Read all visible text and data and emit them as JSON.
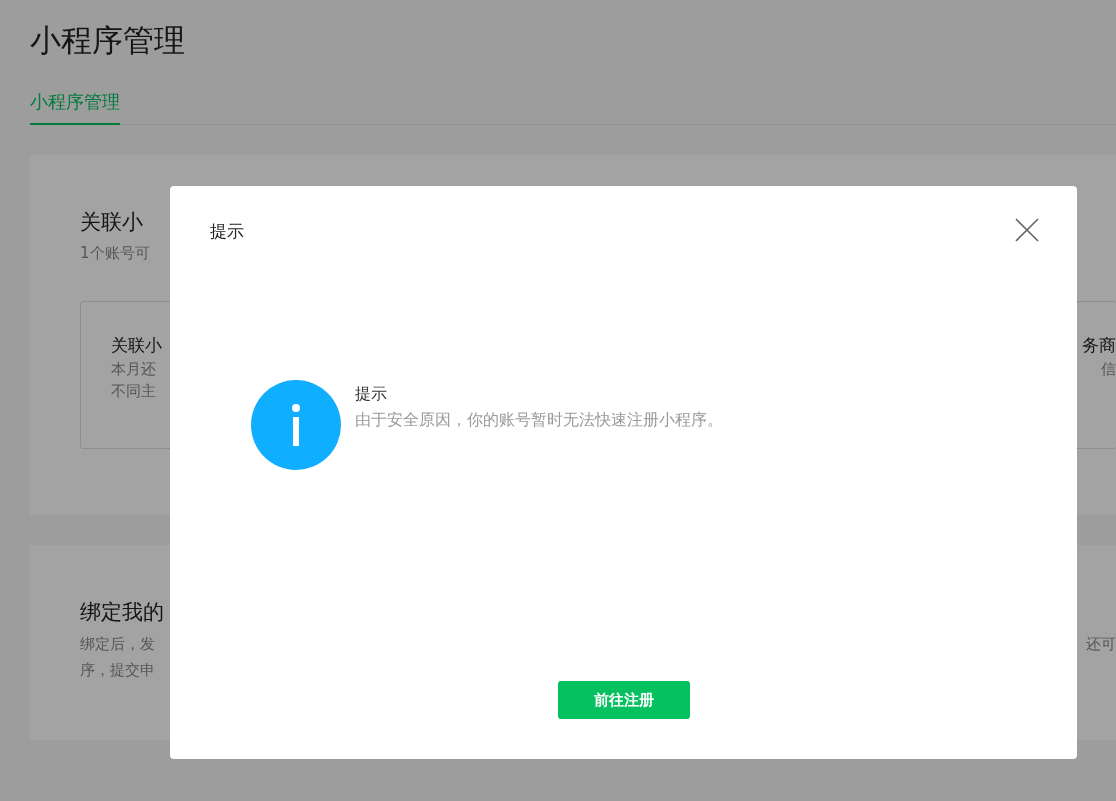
{
  "page": {
    "title": "小程序管理",
    "tabs": [
      {
        "label": "小程序管理",
        "selected": true
      }
    ]
  },
  "sections": [
    {
      "title": "关联小",
      "subtitle": "1个账号可",
      "options": [
        {
          "title": "关联小",
          "lines": [
            "本月还",
            "不同主"
          ]
        },
        {
          "title": "务商",
          "lines": [
            "信"
          ]
        }
      ]
    },
    {
      "title": "绑定我的",
      "lines": [
        "绑定后，发",
        "序，提交申"
      ],
      "right_text": "还可"
    }
  ],
  "dialog": {
    "title": "提示",
    "message_title": "提示",
    "message": "由于安全原因，你的账号暂时无法快速注册小程序。",
    "button": "前往注册"
  }
}
